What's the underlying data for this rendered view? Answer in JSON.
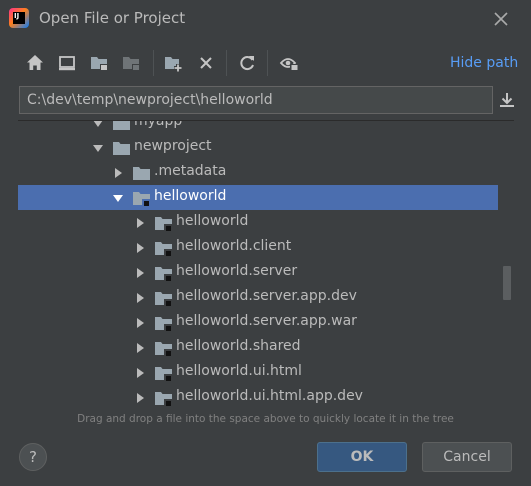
{
  "window": {
    "title": "Open File or Project",
    "app_logo_text": "IJ",
    "app_logo_icon": "intellij-idea-logo"
  },
  "toolbar": {
    "buttons": [
      {
        "icon": "home-icon"
      },
      {
        "icon": "desktop-icon"
      },
      {
        "icon": "project-folder-icon"
      },
      {
        "icon": "module-folder-icon"
      },
      {
        "icon": "new-folder-icon"
      },
      {
        "icon": "delete-icon"
      },
      {
        "icon": "refresh-icon"
      },
      {
        "icon": "show-hidden-icon"
      }
    ],
    "hide_path_label": "Hide path"
  },
  "path": {
    "value": "C:\\dev\\temp\\newproject\\helloworld"
  },
  "tree": {
    "rows": [
      {
        "label": "myapp",
        "expanded": true,
        "selected": false
      },
      {
        "label": "newproject",
        "expanded": true,
        "selected": false
      },
      {
        "label": ".metadata",
        "expanded": false,
        "selected": false
      },
      {
        "label": "helloworld",
        "expanded": true,
        "selected": true
      },
      {
        "label": "helloworld",
        "expanded": false,
        "selected": false
      },
      {
        "label": "helloworld.client",
        "expanded": false,
        "selected": false
      },
      {
        "label": "helloworld.server",
        "expanded": false,
        "selected": false
      },
      {
        "label": "helloworld.server.app.dev",
        "expanded": false,
        "selected": false
      },
      {
        "label": "helloworld.server.app.war",
        "expanded": false,
        "selected": false
      },
      {
        "label": "helloworld.shared",
        "expanded": false,
        "selected": false
      },
      {
        "label": "helloworld.ui.html",
        "expanded": false,
        "selected": false
      },
      {
        "label": "helloworld.ui.html.app.dev",
        "expanded": false,
        "selected": false
      }
    ]
  },
  "hint": "Drag and drop a file into the space above to quickly locate it in the tree",
  "footer": {
    "help_label": "?",
    "ok_label": "OK",
    "cancel_label": "Cancel"
  },
  "colors": {
    "background": "#3c3f41",
    "selection": "#4b6eaf",
    "link": "#589df6",
    "ok_button": "#365880"
  }
}
